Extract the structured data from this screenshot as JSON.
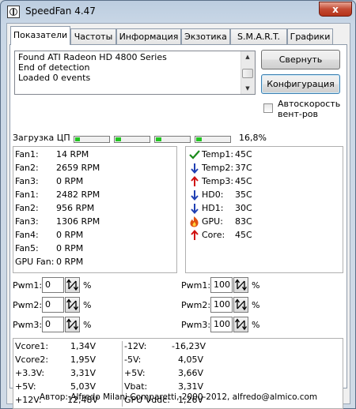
{
  "window": {
    "title": "SpeedFan 4.47",
    "close_label": "x"
  },
  "tabs": [
    {
      "label": "Показатели",
      "active": true
    },
    {
      "label": "Частоты"
    },
    {
      "label": "Информация"
    },
    {
      "label": "Экзотика"
    },
    {
      "label": "S.M.A.R.T."
    },
    {
      "label": "Графики"
    }
  ],
  "log": {
    "lines": [
      "Found ATI Radeon HD 4800 Series",
      "End of detection",
      "Loaded 0 events"
    ]
  },
  "buttons": {
    "minimize": "Свернуть",
    "configure": "Конфигурация"
  },
  "autospeed": {
    "label_line1": "Автоскорость",
    "label_line2": "вент-ров",
    "checked": false
  },
  "cpu": {
    "label": "Загрузка ЦП",
    "percent": "16,8%",
    "cores": [
      0.15,
      0.17,
      0.16,
      0.18
    ]
  },
  "fans": [
    {
      "name": "Fan1:",
      "value": "14 RPM"
    },
    {
      "name": "Fan2:",
      "value": "2659 RPM"
    },
    {
      "name": "Fan3:",
      "value": "0 RPM"
    },
    {
      "name": "Fan1:",
      "value": "2482 RPM"
    },
    {
      "name": "Fan2:",
      "value": "956 RPM"
    },
    {
      "name": "Fan3:",
      "value": "1306 RPM"
    },
    {
      "name": "Fan4:",
      "value": "0 RPM"
    },
    {
      "name": "Fan5:",
      "value": "0 RPM"
    },
    {
      "name": "GPU Fan:",
      "value": "0 RPM"
    }
  ],
  "temps": [
    {
      "name": "Temp1:",
      "value": "45C",
      "icon": "check-icon",
      "color": "#1a8a1a"
    },
    {
      "name": "Temp2:",
      "value": "37C",
      "icon": "arrow-down-icon",
      "color": "#1f3fb3"
    },
    {
      "name": "Temp3:",
      "value": "45C",
      "icon": "arrow-up-icon",
      "color": "#d01010"
    },
    {
      "name": "HD0:",
      "value": "35C",
      "icon": "arrow-down-icon",
      "color": "#1f3fb3"
    },
    {
      "name": "HD1:",
      "value": "30C",
      "icon": "arrow-down-icon",
      "color": "#1f3fb3"
    },
    {
      "name": "GPU:",
      "value": "83C",
      "icon": "fire-icon",
      "color": "#e05010"
    },
    {
      "name": "Core:",
      "value": "45C",
      "icon": "arrow-up-icon",
      "color": "#d01010"
    }
  ],
  "pwm_left": [
    {
      "label": "Pwm1:",
      "value": "0",
      "unit": "%"
    },
    {
      "label": "Pwm2:",
      "value": "0",
      "unit": "%"
    },
    {
      "label": "Pwm3:",
      "value": "0",
      "unit": "%"
    }
  ],
  "pwm_right": [
    {
      "label": "Pwm1:",
      "value": "100",
      "unit": "%"
    },
    {
      "label": "Pwm2:",
      "value": "100",
      "unit": "%"
    },
    {
      "label": "Pwm3:",
      "value": "100",
      "unit": "%"
    }
  ],
  "voltages_left": [
    {
      "name": "Vcore1:",
      "value": "1,34V"
    },
    {
      "name": "Vcore2:",
      "value": "1,95V"
    },
    {
      "name": "+3.3V:",
      "value": "3,31V"
    },
    {
      "name": "+5V:",
      "value": "5,03V"
    },
    {
      "name": "+12V:",
      "value": "12,48V"
    }
  ],
  "voltages_right": [
    {
      "name": "-12V:",
      "value": "-16,23V"
    },
    {
      "name": "-5V:",
      "value": "4,05V"
    },
    {
      "name": "+5V:",
      "value": "3,66V"
    },
    {
      "name": "Vbat:",
      "value": "3,31V"
    },
    {
      "name": "GPU Vddc:",
      "value": "1,26V"
    }
  ],
  "footer": {
    "text": "Автор: Alfredo Milani Comparetti, 2000-2012, alfredo@almico.com"
  }
}
